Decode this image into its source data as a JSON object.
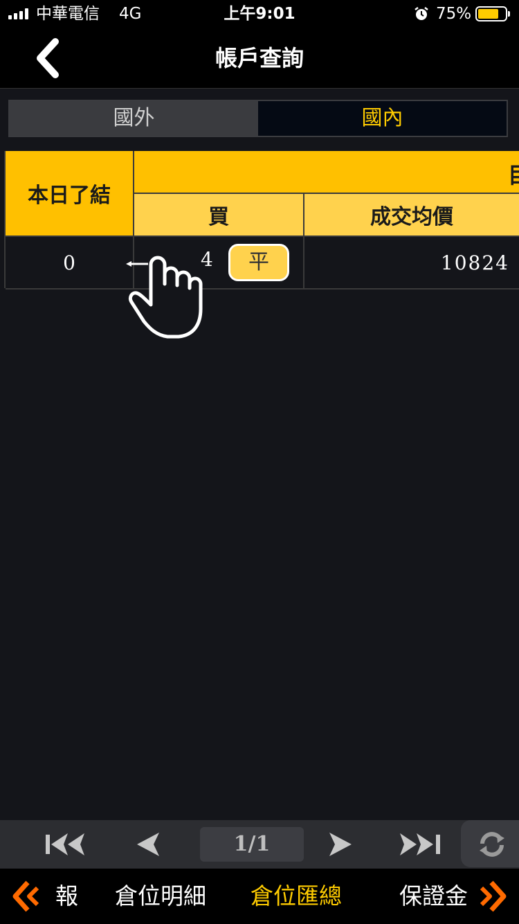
{
  "status_bar": {
    "carrier": "中華電信",
    "network": "4G",
    "time": "上午9:01",
    "battery_percent": "75%",
    "battery_level": 0.75,
    "icons": [
      "signal-icon",
      "alarm-icon",
      "battery-icon"
    ]
  },
  "nav": {
    "back_icon": "chevron-left-icon",
    "title": "帳戶查詢"
  },
  "segments": {
    "foreign": "國外",
    "domestic": "國內",
    "selected": "domestic"
  },
  "table": {
    "header_settle": "本日了結",
    "header_group_partial": "目",
    "header_buy": "買",
    "header_avg_price": "成交均價",
    "rows": [
      {
        "settle": "0",
        "buy_qty": "4",
        "close_label": "平",
        "avg_price": "10824"
      }
    ]
  },
  "pager": {
    "page": "1/1",
    "icons": [
      "first-page-icon",
      "prev-page-icon",
      "next-page-icon",
      "last-page-icon",
      "refresh-icon"
    ]
  },
  "bottom_tabs": {
    "items": [
      "報",
      "倉位明細",
      "倉位匯總",
      "保證金"
    ],
    "active": "倉位匯總",
    "icons": [
      "chevron-left-icon",
      "chevron-right-icon"
    ]
  },
  "colors": {
    "accent": "#ffcc00",
    "header": "#ffc000",
    "header_light": "#ffd24d",
    "background": "#14151a"
  },
  "overlay": {
    "icon": "swipe-hand-icon"
  }
}
